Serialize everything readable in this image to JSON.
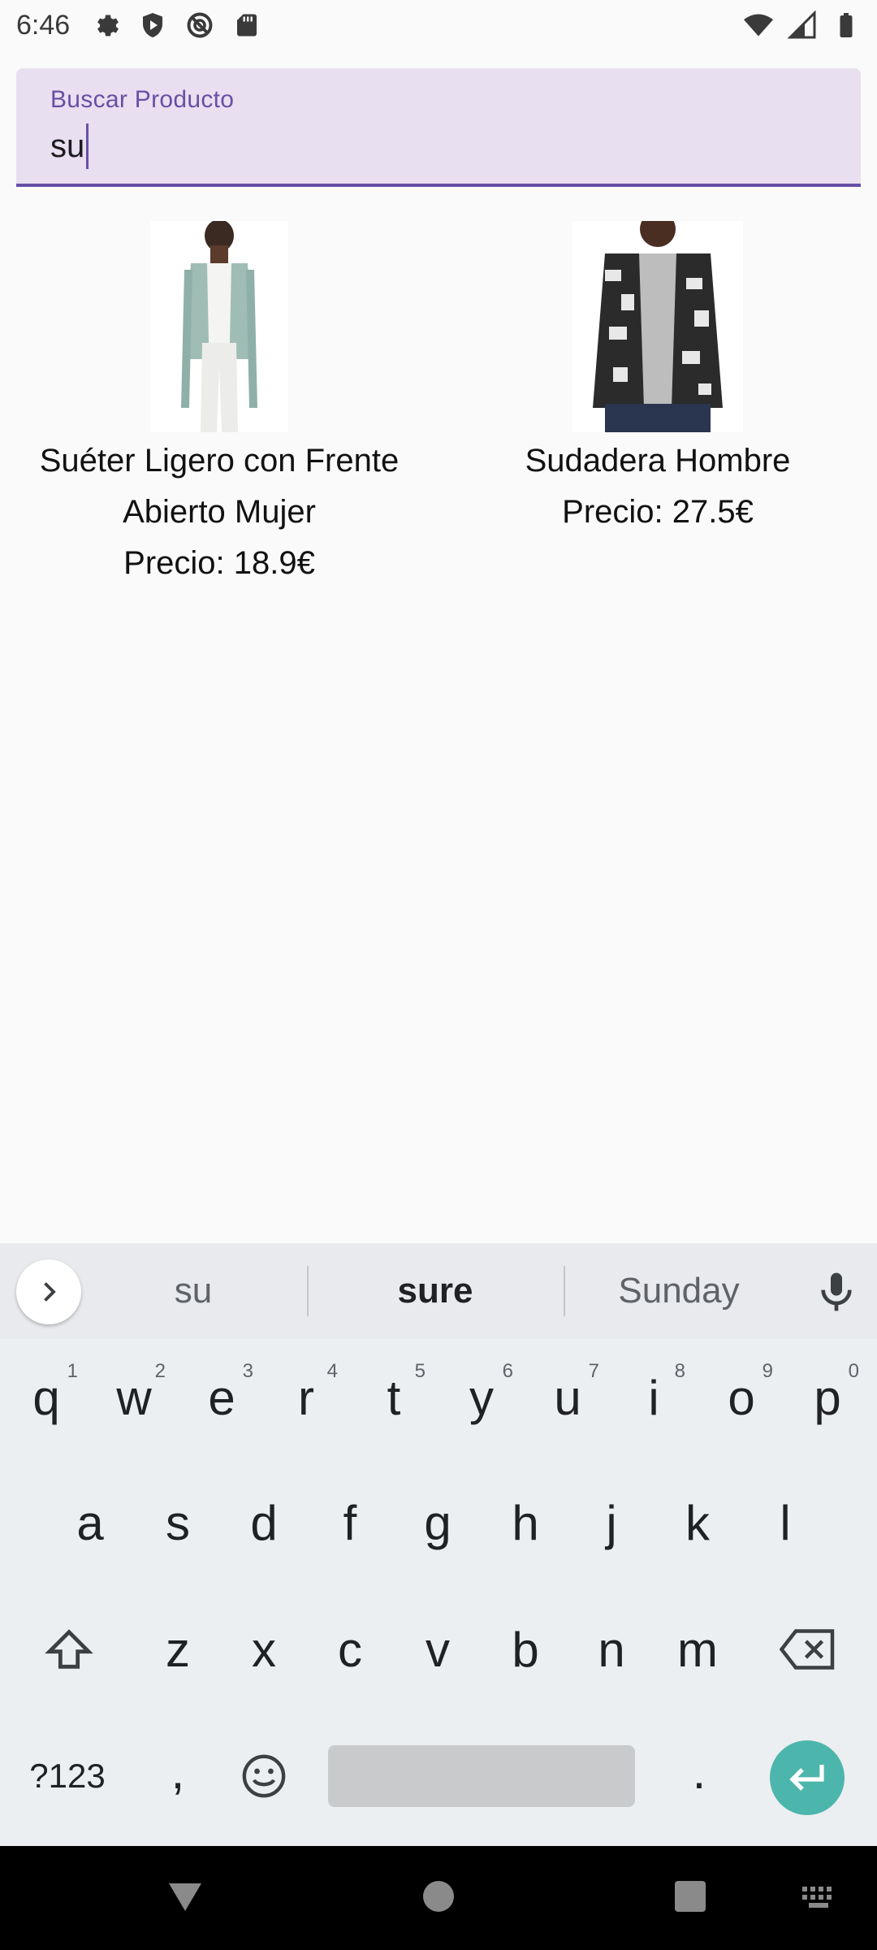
{
  "status_bar": {
    "time": "6:46",
    "left_icons": [
      "settings-icon",
      "shield-play-icon",
      "blocked-icon",
      "sd-card-icon"
    ],
    "right_icons": [
      "wifi-icon",
      "signal-icon",
      "battery-icon"
    ]
  },
  "search": {
    "label": "Buscar Producto",
    "value": "su"
  },
  "products": [
    {
      "name": "Suéter Ligero con Frente Abierto Mujer",
      "price": "Precio: 18.9€"
    },
    {
      "name": "Sudadera Hombre",
      "price": "Precio: 27.5€"
    }
  ],
  "keyboard": {
    "suggestions": [
      "su",
      "sure",
      "Sunday"
    ],
    "row1": [
      {
        "key": "q",
        "hint": "1"
      },
      {
        "key": "w",
        "hint": "2"
      },
      {
        "key": "e",
        "hint": "3"
      },
      {
        "key": "r",
        "hint": "4"
      },
      {
        "key": "t",
        "hint": "5"
      },
      {
        "key": "y",
        "hint": "6"
      },
      {
        "key": "u",
        "hint": "7"
      },
      {
        "key": "i",
        "hint": "8"
      },
      {
        "key": "o",
        "hint": "9"
      },
      {
        "key": "p",
        "hint": "0"
      }
    ],
    "row2": [
      "a",
      "s",
      "d",
      "f",
      "g",
      "h",
      "j",
      "k",
      "l"
    ],
    "row3": [
      "z",
      "x",
      "c",
      "v",
      "b",
      "n",
      "m"
    ],
    "symbols_label": "?123",
    "comma": ",",
    "period": "."
  },
  "colors": {
    "accent": "#6750a4",
    "search_bg": "#e8dff0",
    "enter_key": "#4db6ac",
    "keyboard_bg": "#eceff1"
  }
}
